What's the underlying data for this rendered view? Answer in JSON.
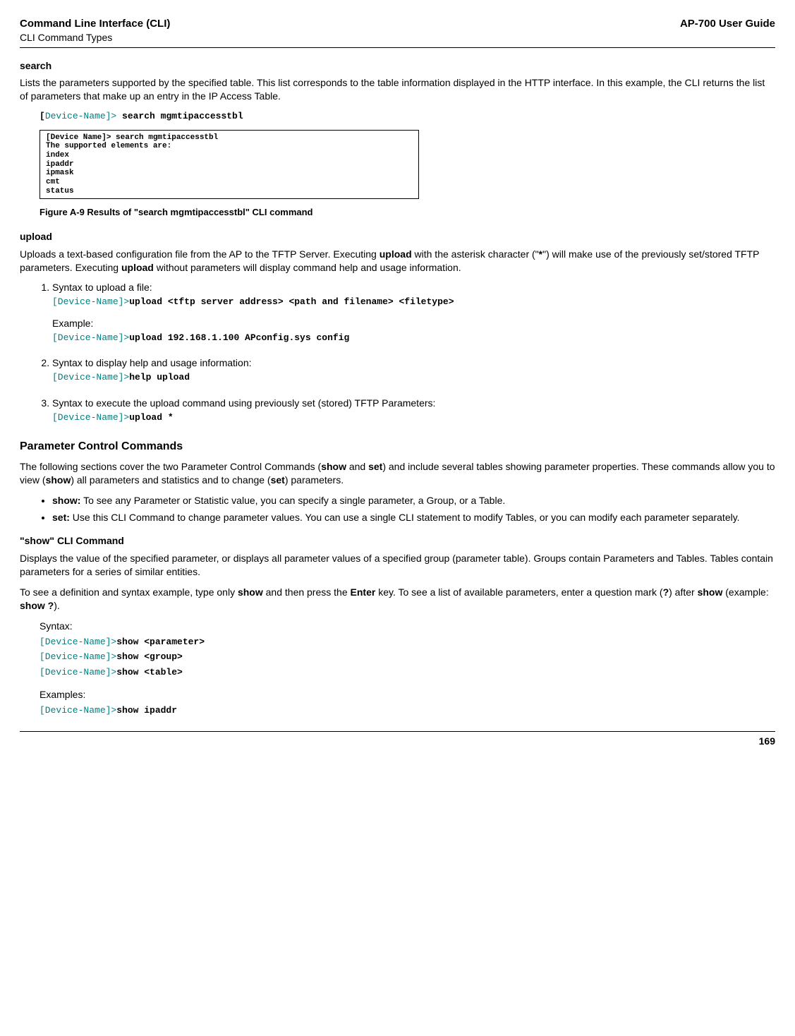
{
  "header": {
    "title": "Command Line Interface (CLI)",
    "subtitle": "CLI Command Types",
    "guide": "AP-700 User Guide"
  },
  "search": {
    "heading": "search",
    "desc": "Lists the parameters supported by the specified table. This list corresponds to the table information displayed in the HTTP interface. In this example, the CLI returns the list of parameters that make up an entry in the IP Access Table.",
    "promptPrefix": "[",
    "promptText": "Device-Name]> ",
    "cmd": "search mgmtipaccesstbl",
    "box": {
      "l1": "[Device Name]> search mgmtipaccesstbl",
      "l2": "The supported elements are:",
      "l3": "index",
      "l4": "ipaddr",
      "l5": "ipmask",
      "l6": "cmt",
      "l7": "status"
    },
    "caption": "Figure A-9 Results of \"search mgmtipaccesstbl\" CLI command"
  },
  "upload": {
    "heading": "upload",
    "desc1a": "Uploads a text-based configuration file from the AP to the TFTP Server. Executing ",
    "desc1b": "upload",
    "desc1c": " with the asterisk character (\"",
    "desc1d": "*",
    "desc1e": "\") will make use of the previously set/stored TFTP parameters. Executing ",
    "desc1f": "upload",
    "desc1g": " without parameters will display command help and usage information.",
    "item1": {
      "label": "Syntax to upload a file:",
      "prompt": "[Device-Name]>",
      "cmd": "upload <tftp server address> <path and filename> <filetype>",
      "example": "Example:",
      "prompt2": "[Device-Name]>",
      "cmd2": "upload 192.168.1.100 APconfig.sys config"
    },
    "item2": {
      "label": "Syntax to display help and usage information:",
      "prompt": "[Device-Name]>",
      "cmd": "help upload"
    },
    "item3": {
      "label": "Syntax to execute the upload command using previously set (stored) TFTP Parameters:",
      "prompt": "[Device-Name]>",
      "cmd": "upload *"
    }
  },
  "paramctrl": {
    "heading": "Parameter Control Commands",
    "desc1": "The following sections cover the two Parameter Control Commands (",
    "show1": "show",
    "desc2": " and ",
    "set1": "set",
    "desc3": ") and include several tables showing parameter properties. These commands allow you to view (",
    "show2": "show",
    "desc4": ") all parameters and statistics and to change (",
    "set2": "set",
    "desc5": ") parameters.",
    "bullet1a": "show:",
    "bullet1b": " To see any Parameter or Statistic value, you can specify a single parameter, a Group, or a Table.",
    "bullet2a": "set:",
    "bullet2b": " Use this CLI Command to change parameter values. You can use a single CLI statement to modify Tables, or you can modify each parameter separately."
  },
  "showcmd": {
    "heading": "\"show\" CLI Command",
    "desc1": "Displays the value of the specified parameter, or displays all parameter values of a specified group (parameter table). Groups contain Parameters and Tables. Tables contain parameters for a series of similar entities.",
    "desc2a": "To see a definition and syntax example, type only ",
    "desc2b": "show",
    "desc2c": " and then press the ",
    "desc2d": "Enter",
    "desc2e": " key. To see a list of available parameters, enter a question mark (",
    "desc2f": "?",
    "desc2g": ") after ",
    "desc2h": "show",
    "desc2i": " (example: ",
    "desc2j": "show ?",
    "desc2k": ").",
    "syntax": "Syntax:",
    "p1": "[Device-Name]>",
    "c1": "show <parameter>",
    "p2": "[Device-Name]>",
    "c2": "show <group>",
    "p3": "[Device-Name]>",
    "c3": "show <table>",
    "examples": "Examples:",
    "p4": "[Device-Name]>",
    "c4": "show ipaddr"
  },
  "footer": {
    "page": "169"
  }
}
